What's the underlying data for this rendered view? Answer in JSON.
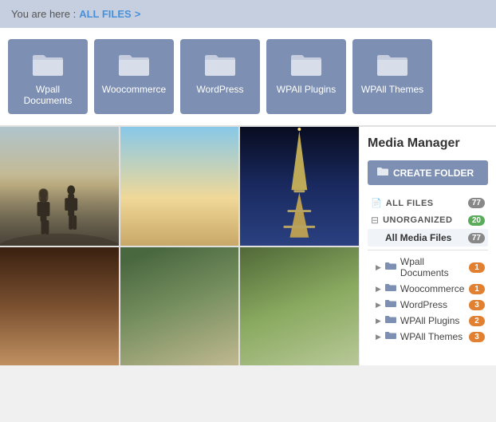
{
  "breadcrumb": {
    "prefix": "You are here :",
    "link_text": "ALL FILES",
    "arrow": ">"
  },
  "folders": [
    {
      "id": "wpall-documents",
      "label": "Wpall Documents"
    },
    {
      "id": "woocommerce",
      "label": "Woocommerce"
    },
    {
      "id": "wordpress",
      "label": "WordPress"
    },
    {
      "id": "wpall-plugins",
      "label": "WPAll Plugins"
    },
    {
      "id": "wpall-themes",
      "label": "WPAll Themes"
    }
  ],
  "images": [
    {
      "id": "beach-couple",
      "class": "img-beach-couple"
    },
    {
      "id": "child-beach",
      "class": "img-child-beach"
    },
    {
      "id": "eiffel",
      "class": "img-eiffel"
    },
    {
      "id": "coffee",
      "class": "img-coffee"
    },
    {
      "id": "portrait",
      "class": "img-portrait"
    },
    {
      "id": "hand",
      "class": "img-hand"
    }
  ],
  "sidebar": {
    "title": "Media Manager",
    "create_folder_btn": "CREATE FOLDER",
    "items": [
      {
        "id": "all-files",
        "label": "ALL FILES",
        "badge": "77",
        "badge_type": "badge-gray",
        "active": false
      },
      {
        "id": "unorganized",
        "label": "UNORGANIZED",
        "badge": "20",
        "badge_type": "badge-green",
        "active": false
      },
      {
        "id": "all-media-files",
        "label": "All Media Files",
        "badge": "77",
        "badge_type": "badge-gray",
        "active": true
      }
    ],
    "tree_items": [
      {
        "id": "tree-wpall-documents",
        "label": "Wpall Documents",
        "badge": "1",
        "badge_type": "badge-orange"
      },
      {
        "id": "tree-woocommerce",
        "label": "Woocommerce",
        "badge": "1",
        "badge_type": "badge-orange"
      },
      {
        "id": "tree-wordpress",
        "label": "WordPress",
        "badge": "3",
        "badge_type": "badge-orange"
      },
      {
        "id": "tree-wpall-plugins",
        "label": "WPAll Plugins",
        "badge": "2",
        "badge_type": "badge-orange"
      },
      {
        "id": "tree-wpall-themes",
        "label": "WPAll Themes",
        "badge": "3",
        "badge_type": "badge-orange"
      }
    ]
  }
}
